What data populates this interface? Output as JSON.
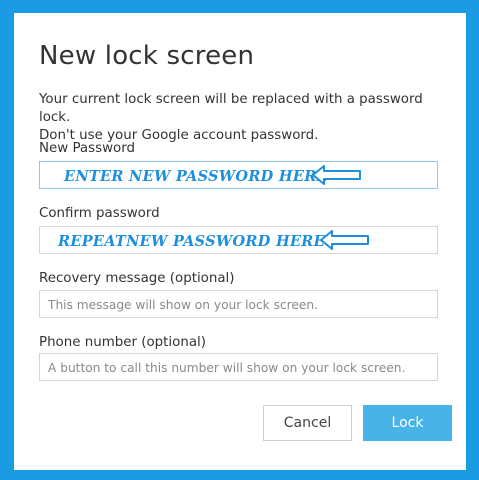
{
  "dialog": {
    "title": "New lock screen",
    "description_line1": "Your current lock screen will be replaced with a password lock.",
    "description_line2": "Don't use your Google account password."
  },
  "fields": {
    "new_password": {
      "label": "New Password",
      "value": "ENTER NEW PASSWORD HERE"
    },
    "confirm_password": {
      "label": "Confirm password",
      "value": "REPEATNEW PASSWORD HERE"
    },
    "recovery_message": {
      "label": "Recovery message (optional)",
      "placeholder": "This message will show on your lock screen."
    },
    "phone_number": {
      "label": "Phone number (optional)",
      "placeholder": "A button to call this number will show on your lock screen."
    }
  },
  "buttons": {
    "cancel": "Cancel",
    "lock": "Lock"
  },
  "colors": {
    "background": "#1a9be3",
    "annotation": "#1d8fdc",
    "lock_button": "#47b3e6"
  },
  "icons": {
    "annotation_arrow": "left-arrow-icon"
  }
}
